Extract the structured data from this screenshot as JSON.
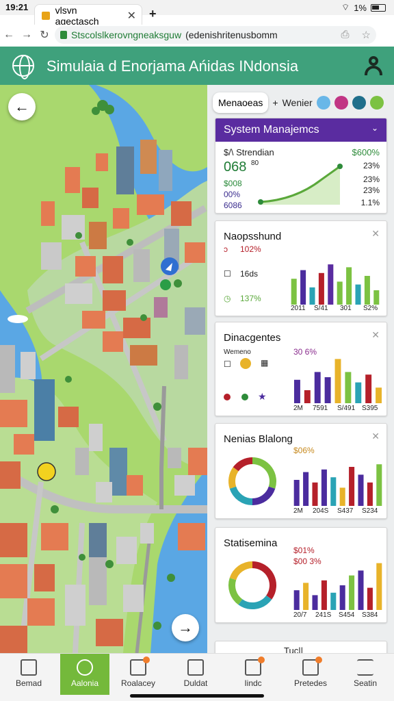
{
  "status_bar": {
    "time": "19:21",
    "battery": "1%"
  },
  "browser": {
    "tab_title": "vlsvn agectasch",
    "new_tab_label": "+",
    "url_secure": "Stscolslkerovngneaksguw",
    "url_rest": "(edenishritenusbomm"
  },
  "app": {
    "title": "Simulaia d Enorjama Ańidas INdonsia"
  },
  "chips": {
    "primary": "Menaoeas",
    "add": "+",
    "secondary": "Wenier"
  },
  "cards": {
    "system": {
      "title": "System Manajemcs",
      "label": "$/\\ Strendian",
      "big_value": "068",
      "big_sup": "80",
      "left_values": [
        "$008",
        "00%",
        "6086"
      ],
      "right_top": "$600%",
      "right_values": [
        "23%",
        "23%",
        "23%",
        "1.1%"
      ]
    },
    "snapshot": {
      "title": "Naopsshund",
      "rows": [
        "102%",
        "16ds",
        "137%"
      ],
      "x_labels": [
        "2011",
        "S/41",
        "301",
        "S2%"
      ],
      "bars": [
        {
          "v": 0.45,
          "c": "#7cc242"
        },
        {
          "v": 0.6,
          "c": "#4b2c9e"
        },
        {
          "v": 0.3,
          "c": "#2aa3b5"
        },
        {
          "v": 0.55,
          "c": "#b5202a"
        },
        {
          "v": 0.7,
          "c": "#5a2ca0"
        },
        {
          "v": 0.4,
          "c": "#7cc242"
        },
        {
          "v": 0.65,
          "c": "#7cc242"
        },
        {
          "v": 0.35,
          "c": "#2aa3b5"
        },
        {
          "v": 0.5,
          "c": "#7cc242"
        },
        {
          "v": 0.25,
          "c": "#7cc242"
        }
      ]
    },
    "diag": {
      "title": "Dinacgentes",
      "sub": "Wemeno",
      "pct": "30 6%",
      "x_labels": [
        "2M",
        "7591",
        "S/491",
        "S395"
      ],
      "bars": [
        {
          "v": 0.45,
          "c": "#4b2c9e"
        },
        {
          "v": 0.25,
          "c": "#b5202a"
        },
        {
          "v": 0.6,
          "c": "#4b2c9e"
        },
        {
          "v": 0.5,
          "c": "#4b2c9e"
        },
        {
          "v": 0.85,
          "c": "#e8b32a"
        },
        {
          "v": 0.6,
          "c": "#7cc242"
        },
        {
          "v": 0.4,
          "c": "#2aa3b5"
        },
        {
          "v": 0.55,
          "c": "#b5202a"
        },
        {
          "v": 0.3,
          "c": "#e8b32a"
        }
      ]
    },
    "nenias": {
      "title": "Nenias Blalong",
      "pct": "$06%",
      "x_labels": [
        "2M",
        "204S",
        "S437",
        "S234"
      ],
      "donut": [
        {
          "v": 0.3,
          "c": "#7cc242"
        },
        {
          "v": 0.2,
          "c": "#4b2c9e"
        },
        {
          "v": 0.2,
          "c": "#2aa3b5"
        },
        {
          "v": 0.15,
          "c": "#e8b32a"
        },
        {
          "v": 0.15,
          "c": "#b5202a"
        }
      ],
      "bars": [
        {
          "v": 0.5,
          "c": "#4b2c9e"
        },
        {
          "v": 0.65,
          "c": "#4b2c9e"
        },
        {
          "v": 0.45,
          "c": "#b5202a"
        },
        {
          "v": 0.7,
          "c": "#4b2c9e"
        },
        {
          "v": 0.55,
          "c": "#2aa3b5"
        },
        {
          "v": 0.35,
          "c": "#e8b32a"
        },
        {
          "v": 0.75,
          "c": "#b5202a"
        },
        {
          "v": 0.6,
          "c": "#4b2c9e"
        },
        {
          "v": 0.45,
          "c": "#b5202a"
        },
        {
          "v": 0.8,
          "c": "#7cc242"
        }
      ]
    },
    "stats": {
      "title": "Statisemina",
      "pct1": "$01%",
      "pct2": "$00 3%",
      "x_labels": [
        "20/7",
        "241S",
        "S454",
        "S384"
      ],
      "donut": [
        {
          "v": 0.35,
          "c": "#b5202a"
        },
        {
          "v": 0.25,
          "c": "#2aa3b5"
        },
        {
          "v": 0.2,
          "c": "#7cc242"
        },
        {
          "v": 0.2,
          "c": "#e8b32a"
        }
      ],
      "bars": [
        {
          "v": 0.4,
          "c": "#4b2c9e"
        },
        {
          "v": 0.55,
          "c": "#e8b32a"
        },
        {
          "v": 0.3,
          "c": "#4b2c9e"
        },
        {
          "v": 0.6,
          "c": "#b5202a"
        },
        {
          "v": 0.35,
          "c": "#2aa3b5"
        },
        {
          "v": 0.5,
          "c": "#4b2c9e"
        },
        {
          "v": 0.7,
          "c": "#7cc242"
        },
        {
          "v": 0.8,
          "c": "#4b2c9e"
        },
        {
          "v": 0.45,
          "c": "#b5202a"
        },
        {
          "v": 0.95,
          "c": "#e8b32a"
        }
      ]
    },
    "partial": {
      "title": "Tuc||"
    }
  },
  "bottom_nav": [
    {
      "label": "Bemad",
      "icon": "home-icon"
    },
    {
      "label": "Aalonia",
      "icon": "chat-icon"
    },
    {
      "label": "Roalacey",
      "icon": "grid-icon"
    },
    {
      "label": "Duldat",
      "icon": "building-icon"
    },
    {
      "label": "Iindc",
      "icon": "table-icon"
    },
    {
      "label": "Pretedes",
      "icon": "copy-icon"
    },
    {
      "label": "Seatin",
      "icon": "menu-icon"
    }
  ],
  "colors": {
    "appbar": "#3fa17c",
    "accent_purple": "#5a2ca0",
    "green": "#7cc242",
    "water": "#5aa7e4",
    "land": "#a9d86e"
  }
}
